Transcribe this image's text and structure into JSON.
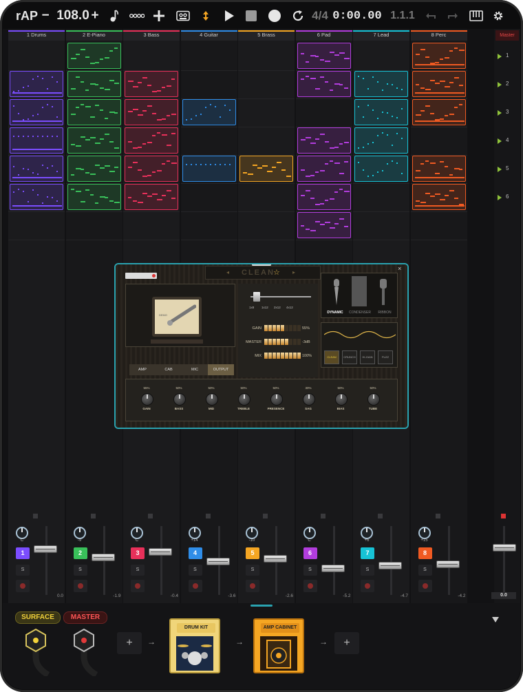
{
  "toolbar": {
    "app_name": "rAP",
    "tempo_minus": "−",
    "tempo": "108.0",
    "tempo_plus": "+",
    "time_signature": "4/4",
    "time_position": "0:00.00",
    "bar_position": "1.1.1"
  },
  "tracks": [
    {
      "label": "1 Drums",
      "color": "#7b4dff",
      "number": "1",
      "pan": "C",
      "volume": "0.0"
    },
    {
      "label": "2 E-Piano",
      "color": "#39c05a",
      "number": "2",
      "pan": "-9",
      "volume": "-1.9"
    },
    {
      "label": "3 Bass",
      "color": "#e8305a",
      "number": "3",
      "pan": "C",
      "volume": "-0.4"
    },
    {
      "label": "4 Guitar",
      "color": "#2f8de8",
      "number": "4",
      "pan": "+14",
      "volume": "-3.6"
    },
    {
      "label": "5 Brass",
      "color": "#f5a623",
      "number": "5",
      "pan": "-10",
      "volume": "-2.6"
    },
    {
      "label": "6 Pad",
      "color": "#b23dde",
      "number": "6",
      "pan": "C",
      "volume": "-5.2"
    },
    {
      "label": "7 Lead",
      "color": "#17c3d6",
      "number": "7",
      "pan": "+6",
      "volume": "-4.7"
    },
    {
      "label": "8 Perc",
      "color": "#f05a22",
      "number": "8",
      "pan": "+15",
      "volume": "-4.2"
    }
  ],
  "master": {
    "label": "Master",
    "volume": "0.0",
    "scenes": [
      "1",
      "2",
      "3",
      "4",
      "5",
      "6"
    ]
  },
  "mixer": {
    "solo_label": "S"
  },
  "amp": {
    "preset_name": "CLEAN",
    "cabinet_options": [
      "1x8",
      "1x12",
      "2x12",
      "4x12"
    ],
    "cabinet_selected": "1X12",
    "meters": [
      {
        "label": "GAIN",
        "value": "55%",
        "level": 0.55
      },
      {
        "label": "MASTER",
        "value": "-3dB",
        "level": 0.62
      },
      {
        "label": "MIX",
        "value": "100%",
        "level": 1.0
      }
    ],
    "mic_types": [
      "DYNAMIC",
      "CONDENSER",
      "RIBBON"
    ],
    "mic_selected": "DYNAMIC",
    "modes": [
      "CLEAN",
      "CRUNCH",
      "HI-GAIN",
      "FUZZ"
    ],
    "mode_selected": "CLEAN",
    "tabs": [
      "AMP",
      "CAB",
      "MIC",
      "OUTPUT"
    ],
    "tab_selected": "OUTPUT",
    "knobs": [
      {
        "label": "GAIN",
        "value": "55%"
      },
      {
        "label": "BASS",
        "value": "50%"
      },
      {
        "label": "MID",
        "value": "50%"
      },
      {
        "label": "TREBLE",
        "value": "50%"
      },
      {
        "label": "PRESENCE",
        "value": "50%"
      },
      {
        "label": "SAG",
        "value": "30%"
      },
      {
        "label": "BIAS",
        "value": "50%"
      },
      {
        "label": "TUBE",
        "value": "50%"
      }
    ]
  },
  "bottom": {
    "surface_label": "SURFACE",
    "master_label": "MASTER",
    "add_label": "+",
    "drum_kit_label": "DRUM KIT",
    "amp_cabinet_label": "AMP CABINET"
  },
  "colors": {
    "accent": "#2aa3b0",
    "background": "#121214"
  }
}
